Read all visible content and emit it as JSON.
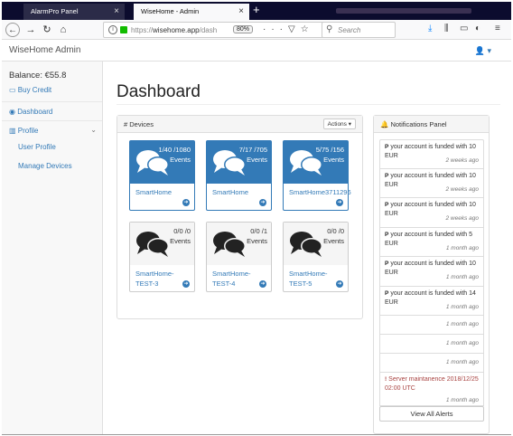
{
  "browser": {
    "tabs": [
      {
        "label": "AlarmPro Panel"
      },
      {
        "label": "WiseHome - Admin"
      }
    ],
    "new_tab": "+",
    "url_prefix": "https://",
    "url_host": "wisehome.app",
    "url_rest": "/dash",
    "zoom": "80%",
    "search_placeholder": "Search"
  },
  "app": {
    "brand": "WiseHome Admin"
  },
  "sidebar": {
    "balance": "Balance: €55.8",
    "buy_credit": "Buy Credit",
    "dashboard": "Dashboard",
    "profile": "Profile",
    "user_profile": "User Profile",
    "manage_devices": "Manage Devices"
  },
  "main": {
    "title": "Dashboard",
    "devices_heading": "Devices",
    "actions_label": "Actions ▾",
    "events_label": "Events",
    "devices": [
      {
        "count": "1/40 /1080",
        "name": "SmartHome",
        "status": "active"
      },
      {
        "count": "7/17 /705",
        "name": "SmartHome",
        "status": "active"
      },
      {
        "count": "5/75 /156",
        "name": "SmartHome3711296",
        "status": "active"
      },
      {
        "count": "0/0 /0",
        "name": "SmartHome-TEST-3",
        "name_line1": "SmartHome-",
        "name_line2": "TEST-3",
        "status": "idle"
      },
      {
        "count": "0/0 /1",
        "name": "SmartHome-TEST-4",
        "name_line1": "SmartHome-",
        "name_line2": "TEST-4",
        "status": "idle"
      },
      {
        "count": "0/0 /0",
        "name": "SmartHome-TEST-5",
        "name_line1": "SmartHome-",
        "name_line2": "TEST-5",
        "status": "idle"
      }
    ]
  },
  "notifications": {
    "heading": "Notifications Panel",
    "items": [
      {
        "text": "your account is funded with 10 EUR",
        "time": "2 weeks ago"
      },
      {
        "text": "your account is funded with 10 EUR",
        "time": "2 weeks ago"
      },
      {
        "text": "your account is funded with 10 EUR",
        "time": "2 weeks ago"
      },
      {
        "text": "your account is funded with 5 EUR",
        "time": "1 month ago"
      },
      {
        "text": "your account is funded with 10 EUR",
        "time": "1 month ago"
      },
      {
        "text": "your account is funded with 14 EUR",
        "time": "1 month ago"
      },
      {
        "text": "",
        "time": "1 month ago"
      },
      {
        "text": "",
        "time": "1 month ago"
      },
      {
        "text": "",
        "time": "1 month ago"
      },
      {
        "text": "Server maintanence 2018/12/25 02:00 UTC",
        "time": "1 month ago"
      }
    ],
    "view_all": "View All Alerts"
  },
  "colors": {
    "primary": "#337ab7",
    "alert": "#a94442"
  }
}
